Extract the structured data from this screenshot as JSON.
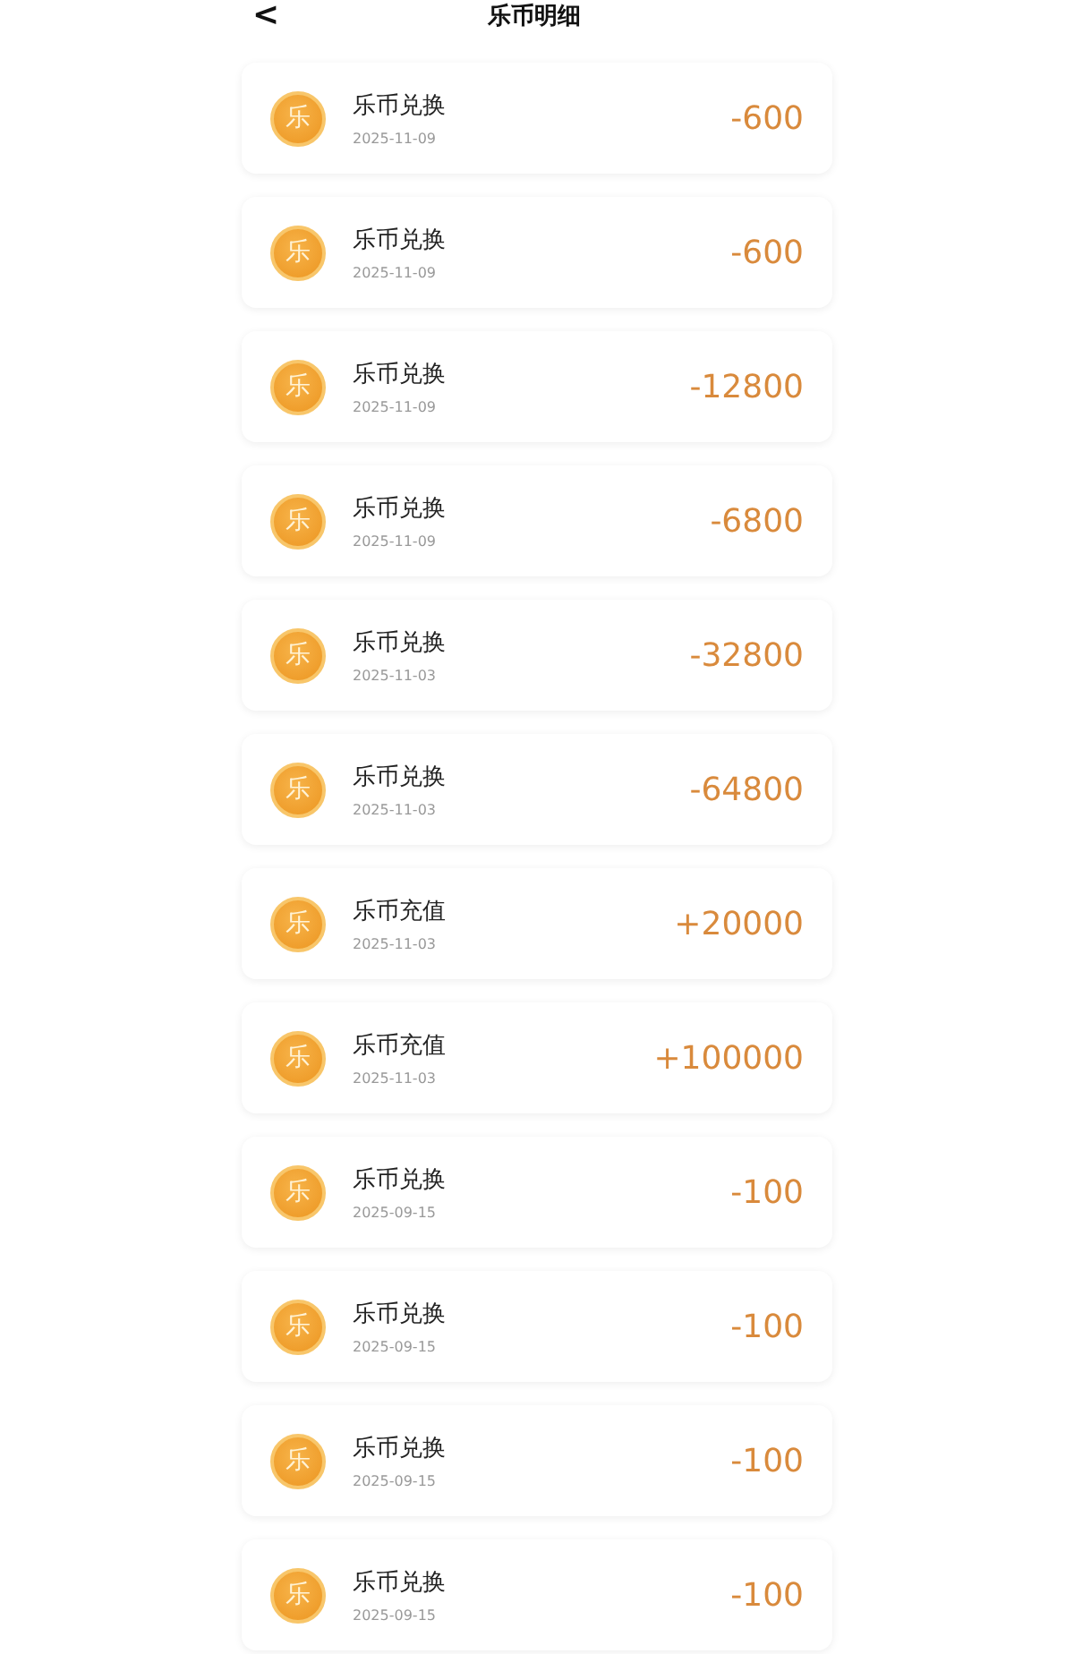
{
  "header": {
    "back": "<",
    "title": "乐币明细"
  },
  "records": [
    {
      "coin": "乐",
      "title": "乐币兑换",
      "date": "2025-11-09",
      "amount": "-600"
    },
    {
      "coin": "乐",
      "title": "乐币兑换",
      "date": "2025-11-09",
      "amount": "-600"
    },
    {
      "coin": "乐",
      "title": "乐币兑换",
      "date": "2025-11-09",
      "amount": "-12800"
    },
    {
      "coin": "乐",
      "title": "乐币兑换",
      "date": "2025-11-09",
      "amount": "-6800"
    },
    {
      "coin": "乐",
      "title": "乐币兑换",
      "date": "2025-11-03",
      "amount": "-32800"
    },
    {
      "coin": "乐",
      "title": "乐币兑换",
      "date": "2025-11-03",
      "amount": "-64800"
    },
    {
      "coin": "乐",
      "title": "乐币充值",
      "date": "2025-11-03",
      "amount": "+20000"
    },
    {
      "coin": "乐",
      "title": "乐币充值",
      "date": "2025-11-03",
      "amount": "+100000"
    },
    {
      "coin": "乐",
      "title": "乐币兑换",
      "date": "2025-09-15",
      "amount": "-100"
    },
    {
      "coin": "乐",
      "title": "乐币兑换",
      "date": "2025-09-15",
      "amount": "-100"
    },
    {
      "coin": "乐",
      "title": "乐币兑换",
      "date": "2025-09-15",
      "amount": "-100"
    },
    {
      "coin": "乐",
      "title": "乐币兑换",
      "date": "2025-09-15",
      "amount": "-100"
    }
  ]
}
